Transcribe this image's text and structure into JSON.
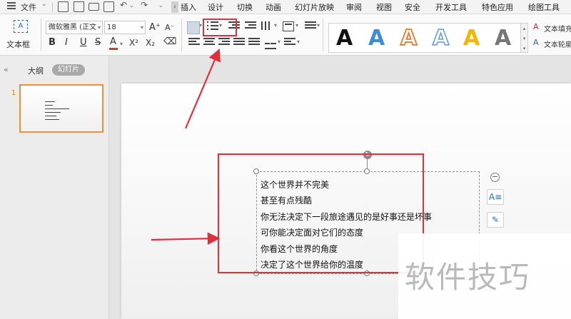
{
  "tabbar": {
    "file_label": "文件",
    "tabs": [
      "插入",
      "设计",
      "切换",
      "动画",
      "幻灯片放映",
      "审阅",
      "视图",
      "安全",
      "开发工具",
      "特色应用",
      "绘图工具"
    ],
    "tabs_visible": [
      "插入",
      "设计",
      "切换",
      "动画",
      "幻灯片放映",
      "审阅",
      "视图",
      "安全",
      "开发工具",
      "特色应用",
      "绘图工具"
    ]
  },
  "ribbon": {
    "textbox_label": "文本框",
    "font_name": "微软雅黑 (正文",
    "font_size": "18",
    "grow_font": "A⁺",
    "shrink_font": "A⁻",
    "bold": "B",
    "italic": "I",
    "underline": "U",
    "strike": "S",
    "font_color": "A",
    "superscript": "X²",
    "subscript": "X₂",
    "wordart_letter": "A",
    "text_fill_label": "文本填充",
    "text_outline_label": "文本轮廓"
  },
  "sidebar": {
    "outline_tab": "大纲",
    "slides_tab": "幻灯片",
    "slide_number": "1"
  },
  "slide": {
    "lines": [
      "这个世界并不完美",
      "甚至有点残酷",
      "你无法决定下一段旅途遇见的是好事还是坏事",
      "可你能决定面对它们的态度",
      "你看这个世界的角度",
      "决定了这个世界给你的温度"
    ]
  },
  "watermark": "软件技巧",
  "colors": {
    "accent_red": "#e0303a",
    "thumb_border": "#e8913d",
    "wordart": [
      "#111111",
      "#3b8fd8",
      "#e8823a",
      "#5a9bd5",
      "#f2b705",
      "#777777"
    ]
  }
}
